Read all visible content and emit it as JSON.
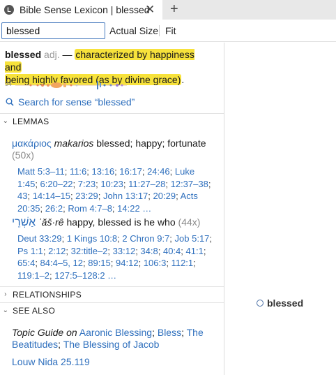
{
  "tab": {
    "logo_glyph": "L",
    "title": "Bible Sense Lexicon | blessed",
    "close_glyph": "✕",
    "add_glyph": "+"
  },
  "toolbar": {
    "search_value": "blessed",
    "actual_size_label": "Actual Size",
    "fit_label": "Fit"
  },
  "definition": {
    "headword": "blessed",
    "pos": "adj.",
    "dash": "—",
    "gloss_line1": "characterized by happiness and",
    "gloss_line2": "being highly favored (as by divine grace)",
    "period": "."
  },
  "frequency": {
    "count": "94"
  },
  "sense_search": {
    "label": "Search for sense “blessed”",
    "icon": "search-icon"
  },
  "sections": {
    "lemmas": "LEMMAS",
    "relationships": "RELATIONSHIPS",
    "see_also": "SEE ALSO"
  },
  "lemma1": {
    "original": "μακάριος",
    "translit": "makarios",
    "gloss": "blessed; happy; fortunate",
    "count": "(50x)",
    "refs": [
      "Matt 5:3–11",
      "11:6",
      "13:16",
      "16:17",
      "24:46",
      "Luke 1:45",
      "6:20–22",
      "7:23",
      "10:23",
      "11:27–28",
      "12:37–38",
      "43",
      "14:14–15",
      "23:29",
      "John 13:17",
      "20:29",
      "Acts 20:35",
      "26:2",
      "Rom 4:7–8",
      "14:22 …"
    ]
  },
  "lemma2": {
    "original": "אַשְׁרֵי",
    "translit": "ʾăš·rê",
    "gloss": "happy, blessed is he who",
    "count": "(44x)",
    "refs": [
      "Deut 33:29",
      "1 Kings 10:8",
      "2 Chron 9:7",
      "Job 5:17",
      "Ps 1:1",
      "2:12",
      "32:title–2",
      "33:12",
      "34:8",
      "40:4",
      "41:1",
      "65:4",
      "84:4–5, 12",
      "89:15",
      "94:12",
      "106:3",
      "112:1",
      "119:1–2",
      "127:5–128:2 …"
    ]
  },
  "see_also": {
    "topic_label": "Topic Guide on",
    "topics": [
      "Aaronic Blessing",
      "Bless",
      "The Beatitudes",
      "The Blessing of Jacob"
    ],
    "louw_nida": "Louw Nida 25.119"
  },
  "right_panel": {
    "selected_sense": "blessed"
  },
  "colors": {
    "link": "#2e6fbd",
    "highlight": "#f7e23b",
    "accent": "#4a7dbf"
  }
}
